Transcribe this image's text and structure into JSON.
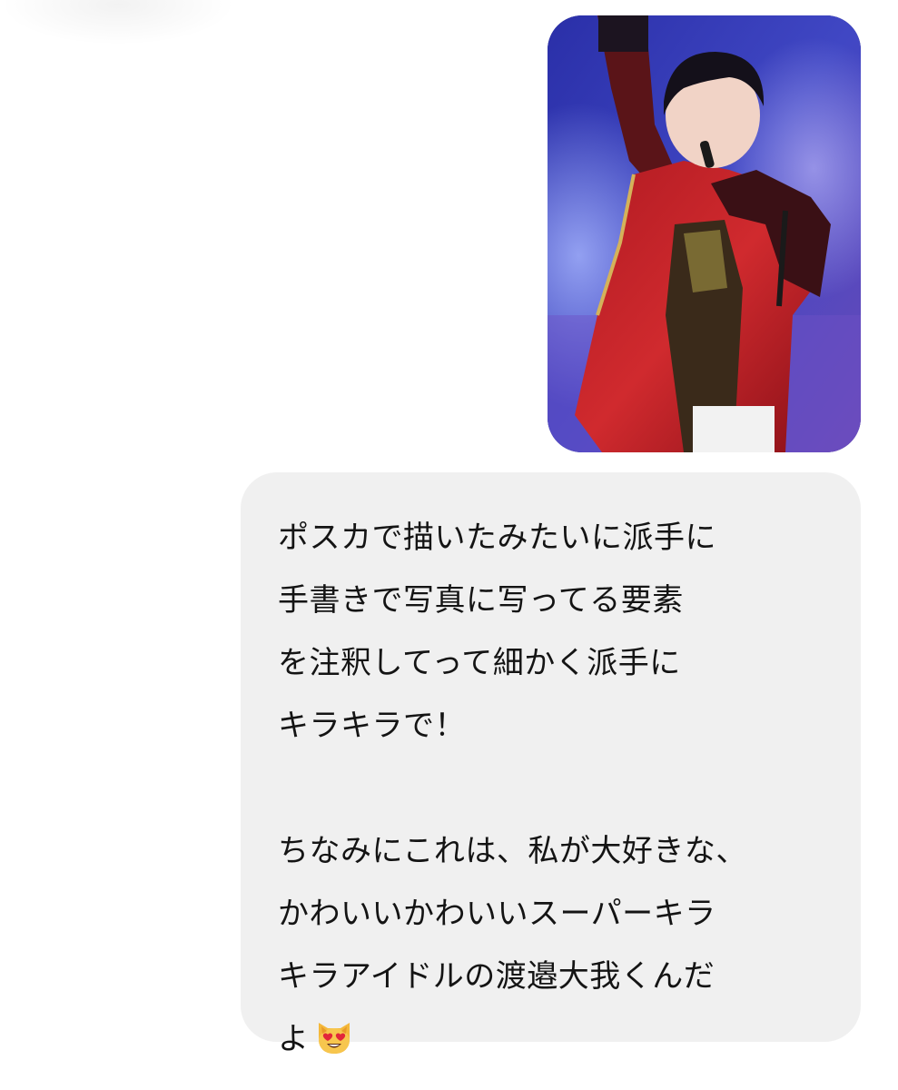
{
  "chat": {
    "image_message": {
      "icon": "photo-concert-performer"
    },
    "text_message": {
      "lines": [
        "ポスカで描いたみたいに派手に",
        "手書きで写真に写ってる要素",
        "を注釈してって細かく派手に",
        "キラキラで！",
        "",
        "ちなみにこれは、私が大好きな、",
        "かわいいかわいいスーパーキラ",
        "キラアイドルの渡邉大我くんだ",
        "よ"
      ],
      "emoji": "heart-eyes-cat-emoji",
      "bubble_color": "#f0f0f0",
      "text_color": "#141414"
    }
  }
}
